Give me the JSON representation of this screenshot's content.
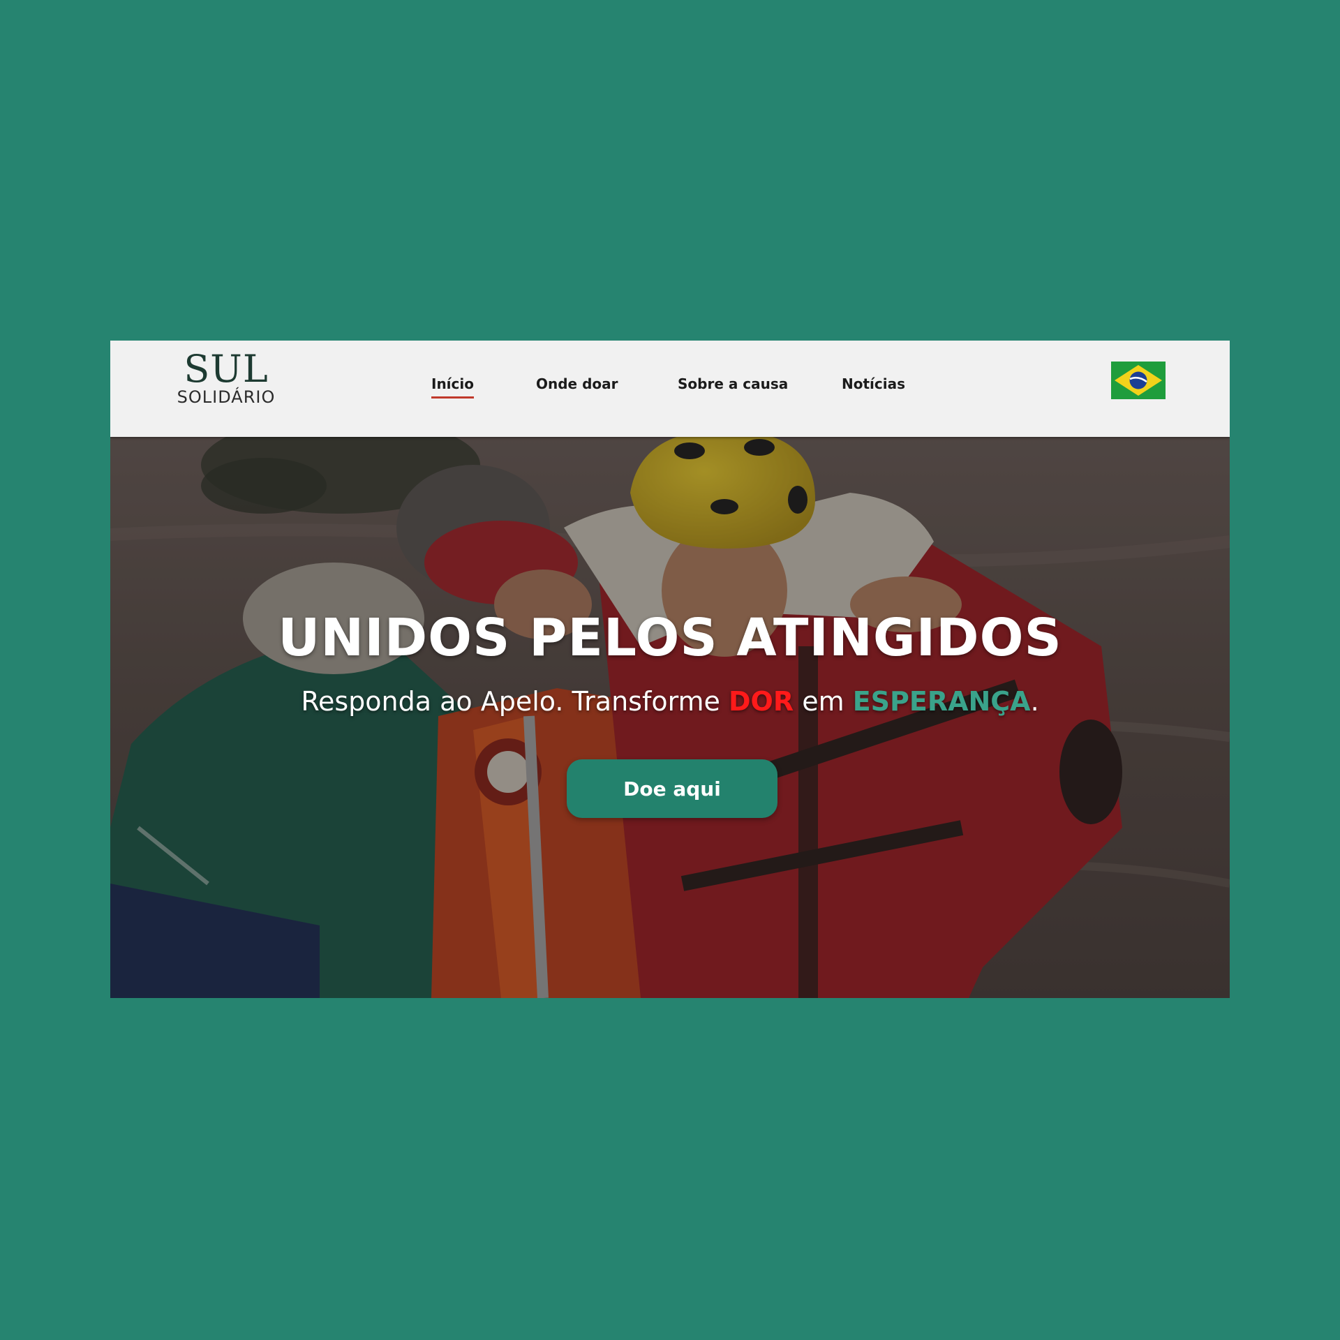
{
  "header": {
    "logo_main": "SUL",
    "logo_sub": "SOLIDÁRIO",
    "nav": [
      {
        "label": "Início",
        "active": true
      },
      {
        "label": "Onde doar",
        "active": false
      },
      {
        "label": "Sobre a causa",
        "active": false
      },
      {
        "label": "Notícias",
        "active": false
      }
    ],
    "language_flag_icon": "brazil-flag-icon"
  },
  "hero": {
    "title": "UNIDOS PELOS ATINGIDOS",
    "subtitle": {
      "part1": "Responda ao Apelo. Transforme ",
      "highlight1": "DOR",
      "part2": " em ",
      "highlight2": "ESPERANÇA",
      "part3": "."
    },
    "cta_label": "Doe aqui"
  },
  "colors": {
    "page_background": "#268470",
    "header_background": "#f1f1f1",
    "cta_background": "#23826d",
    "highlight_pain": "#ff1a1a",
    "highlight_hope": "#3aa38b",
    "active_underline": "#c0392b"
  }
}
